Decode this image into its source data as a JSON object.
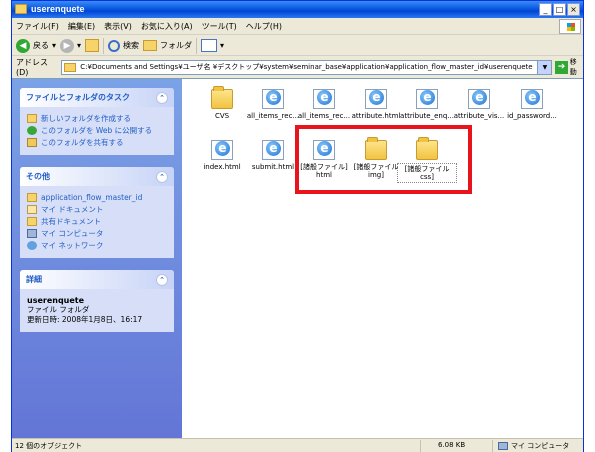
{
  "window": {
    "title": "userenquete"
  },
  "menu": [
    "ファイル(F)",
    "編集(E)",
    "表示(V)",
    "お気に入り(A)",
    "ツール(T)",
    "ヘルプ(H)"
  ],
  "toolbar": {
    "back": "戻る",
    "search": "検索",
    "folders": "フォルダ"
  },
  "address": {
    "label": "アドレス(D)",
    "path": "C:¥Documents and Settings¥ユーザ名 ¥デスクトップ¥system¥seminar_base¥application¥application_flow_master_id¥userenquete",
    "go": "移動"
  },
  "taskpane": {
    "file_tasks": {
      "title": "ファイルとフォルダのタスク",
      "items": [
        "新しいフォルダを作成する",
        "このフォルダを Web に公開する",
        "このフォルダを共有する"
      ]
    },
    "other": {
      "title": "その他",
      "items": [
        "application_flow_master_id",
        "マイ ドキュメント",
        "共有ドキュメント",
        "マイ コンピュータ",
        "マイ ネットワーク"
      ]
    },
    "details": {
      "title": "詳細",
      "name": "userenquete",
      "type": "ファイル フォルダ",
      "modified": "更新日時: 2008年1月8日、16:17"
    }
  },
  "files": [
    {
      "name": "CVS",
      "kind": "folder"
    },
    {
      "name": "all_items_rec...",
      "kind": "html"
    },
    {
      "name": "all_items_rec...",
      "kind": "html"
    },
    {
      "name": "attribute.html",
      "kind": "html"
    },
    {
      "name": "attribute_enq...",
      "kind": "html"
    },
    {
      "name": "attribute_vis...",
      "kind": "html"
    },
    {
      "name": "id_password...",
      "kind": "html"
    },
    {
      "name": "index.html",
      "kind": "html"
    },
    {
      "name": "submit.html",
      "kind": "html"
    },
    {
      "name": "[諸般ファイル] html",
      "kind": "html"
    },
    {
      "name": "[諸般ファイル img]",
      "kind": "folder"
    },
    {
      "name": "[諸般ファイル css]",
      "kind": "folder"
    }
  ],
  "status": {
    "objects": "12 個のオブジェクト",
    "size": "6.08 KB",
    "zone": "マイ コンピュータ"
  }
}
